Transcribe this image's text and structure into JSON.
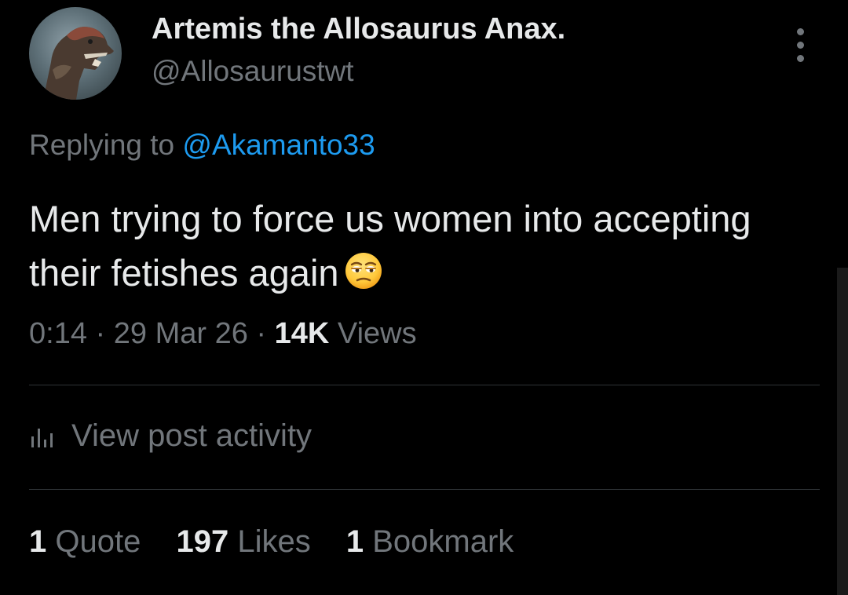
{
  "author": {
    "display_name": "Artemis the Allosaurus Anax.",
    "handle": "@Allosaurustwt"
  },
  "reply": {
    "prefix": "Replying to",
    "mention": "@Akamanto33"
  },
  "tweet": {
    "text": "Men trying to force us women into accepting their fetishes again",
    "emoji": "unamused-face-emoji"
  },
  "meta": {
    "time": "0:14",
    "separator": "·",
    "date": "29 Mar 26",
    "views_count": "14K",
    "views_label": "Views"
  },
  "activity": {
    "label": "View post activity",
    "icon": "bar-chart-icon"
  },
  "stats": [
    {
      "count": "1",
      "label": "Quote"
    },
    {
      "count": "197",
      "label": "Likes"
    },
    {
      "count": "1",
      "label": "Bookmark"
    }
  ],
  "colors": {
    "background": "#000000",
    "primary_text": "#e7e9ea",
    "secondary_text": "#71767b",
    "link": "#1d9bf0",
    "divider": "#2f3336"
  },
  "icons": {
    "more": "more-vertical-icon",
    "avatar": "allosaurus-avatar"
  }
}
